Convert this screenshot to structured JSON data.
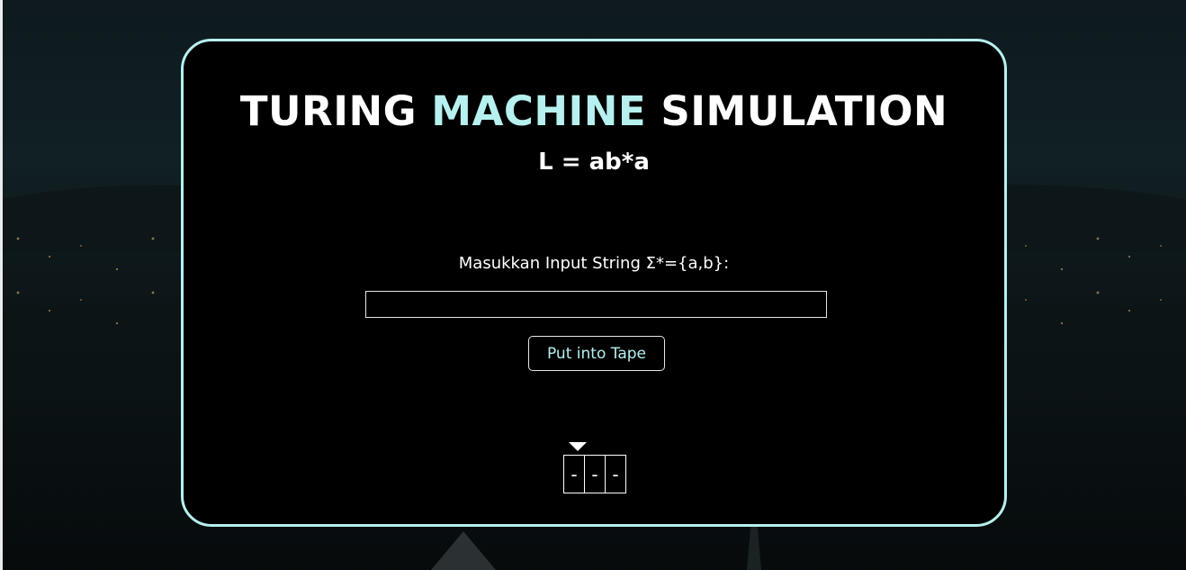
{
  "header": {
    "title_part1": "TURING",
    "title_accent": "MACHINE",
    "title_part2": "SIMULATION",
    "subtitle": "L = ab*a"
  },
  "form": {
    "prompt_label": "Masukkan Input String Σ*={a,b}:",
    "input_value": "",
    "input_placeholder": "",
    "button_label": "Put into Tape"
  },
  "tape": {
    "cells": [
      "-",
      "-",
      "-"
    ],
    "head_index": 0
  },
  "colors": {
    "accent": "#b6f0ef",
    "card_background": "#000000",
    "text": "#ffffff"
  }
}
